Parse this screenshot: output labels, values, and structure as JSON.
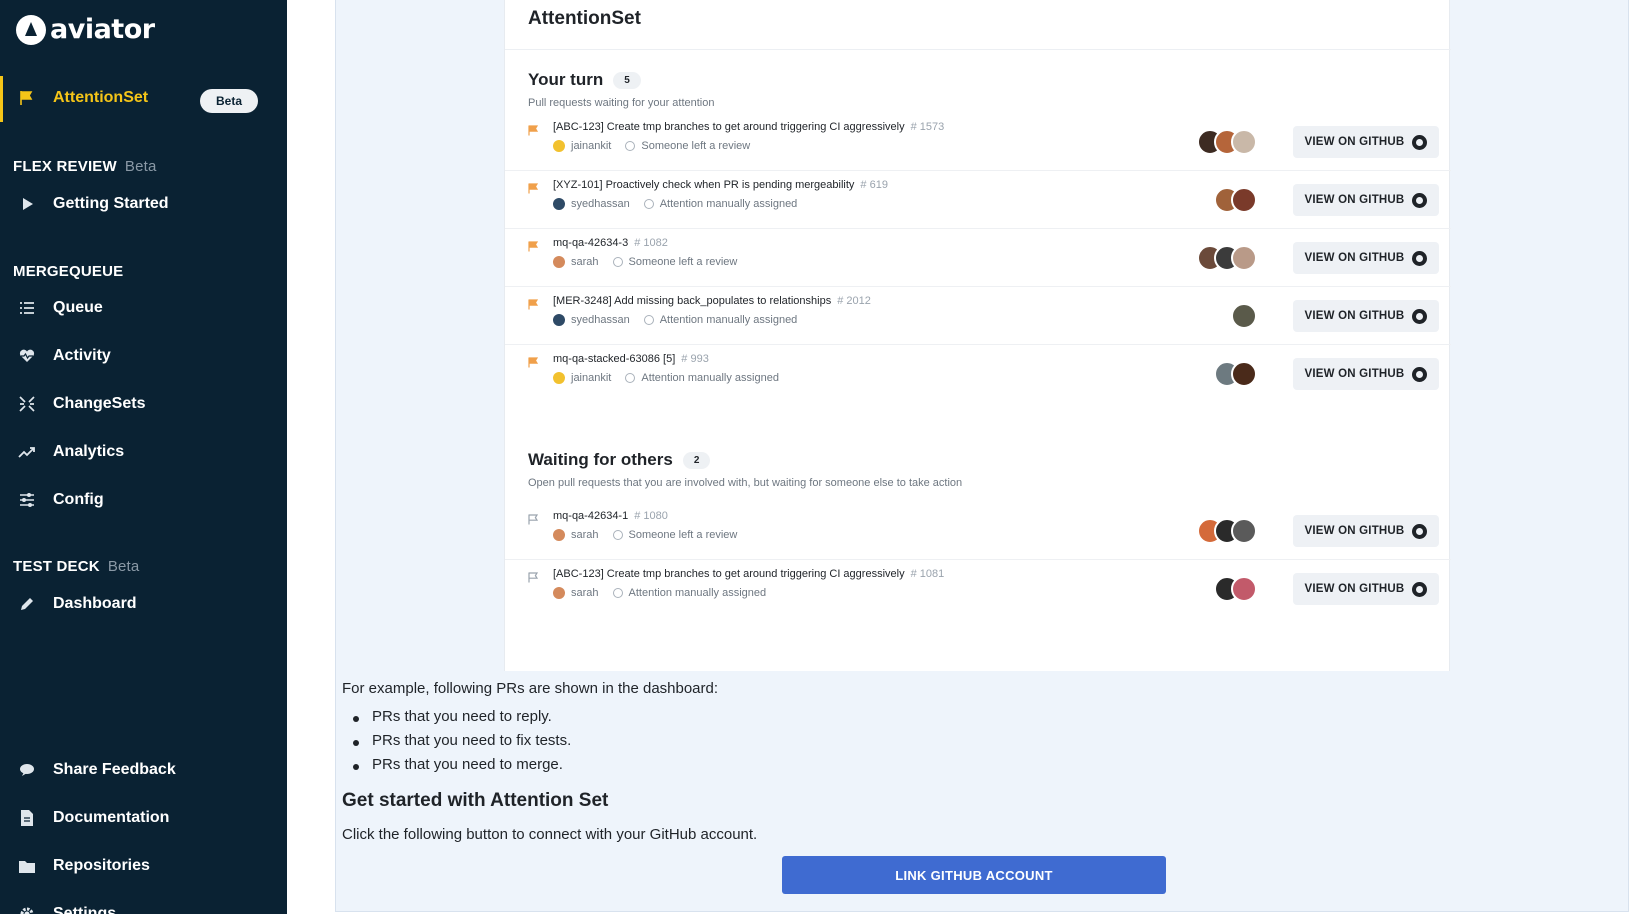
{
  "brand": {
    "name": "aviator"
  },
  "sidebar": {
    "attention": {
      "label": "AttentionSet",
      "badge": "Beta"
    },
    "sections": [
      {
        "title": "FLEX REVIEW",
        "beta": "Beta"
      },
      {
        "title": "MERGEQUEUE"
      },
      {
        "title": "TEST DECK",
        "beta": "Beta"
      }
    ],
    "items": {
      "getting_started": "Getting Started",
      "queue": "Queue",
      "activity": "Activity",
      "changesets": "ChangeSets",
      "analytics": "Analytics",
      "config": "Config",
      "dashboard": "Dashboard",
      "share_feedback": "Share Feedback",
      "documentation": "Documentation",
      "repositories": "Repositories",
      "settings": "Settings"
    }
  },
  "card": {
    "title": "AttentionSet",
    "your_turn": {
      "title": "Your turn",
      "count": "5",
      "subtitle": "Pull requests waiting for your attention"
    },
    "waiting": {
      "title": "Waiting for others",
      "count": "2",
      "subtitle": "Open pull requests that you are involved with, but waiting for someone else to take action"
    },
    "button_label": "VIEW ON GITHUB",
    "prs": [
      {
        "title": "[ABC-123] Create tmp branches to get around triggering CI aggressively",
        "number": "# 1573",
        "author": "jainankit",
        "status": "Someone left a review",
        "flag_color": "#f0a04b",
        "author_color": "#f2c12e",
        "avatars": [
          "#3d2b22",
          "#b5653a",
          "#c9b8a8"
        ]
      },
      {
        "title": "[XYZ-101] Proactively check when PR is pending mergeability",
        "number": "# 619",
        "author": "syedhassan",
        "status": "Attention manually assigned",
        "flag_color": "#f0a04b",
        "author_color": "#2e4a66",
        "avatars": [
          "#a0623a",
          "#7a3a2a"
        ]
      },
      {
        "title": "mq-qa-42634-3",
        "number": "# 1082",
        "author": "sarah",
        "status": "Someone left a review",
        "flag_color": "#f0a04b",
        "author_color": "#d48a5c",
        "avatars": [
          "#6b4a3a",
          "#3b3b3b",
          "#b99a88"
        ]
      },
      {
        "title": "[MER-3248] Add missing back_populates to relationships",
        "number": "# 2012",
        "author": "syedhassan",
        "status": "Attention manually assigned",
        "flag_color": "#f0a04b",
        "author_color": "#2e4a66",
        "avatars": [
          "#5a5a4a"
        ]
      },
      {
        "title": "mq-qa-stacked-63086 [5]",
        "number": "# 993",
        "author": "jainankit",
        "status": "Attention manually assigned",
        "flag_color": "#f0a04b",
        "author_color": "#f2c12e",
        "avatars": [
          "#6d7a80",
          "#4a2a1a"
        ]
      },
      {
        "title": "mq-qa-42634-1",
        "number": "# 1080",
        "author": "sarah",
        "status": "Someone left a review",
        "flag_color": "#9aa3ad",
        "author_color": "#d48a5c",
        "avatars": [
          "#d46a3a",
          "#2a2a2a",
          "#5a5a5a"
        ]
      },
      {
        "title": "[ABC-123] Create tmp branches to get around triggering CI aggressively",
        "number": "# 1081",
        "author": "sarah",
        "status": "Attention manually assigned",
        "flag_color": "#9aa3ad",
        "author_color": "#d48a5c",
        "avatars": [
          "#2a2a2a",
          "#c25a6a"
        ]
      }
    ]
  },
  "doc": {
    "intro": "For example, following PRs are shown in the dashboard:",
    "bullets": [
      "PRs that you need to reply.",
      "PRs that you need to fix tests.",
      "PRs that you need to merge."
    ],
    "heading": "Get started with Attention Set",
    "body": "Click the following button to connect with your GitHub account.",
    "button": "LINK GITHUB ACCOUNT"
  },
  "colors": {
    "sidebar_bg": "#0a2233",
    "active": "#f5c518",
    "primary_button": "#3f6bd1"
  }
}
